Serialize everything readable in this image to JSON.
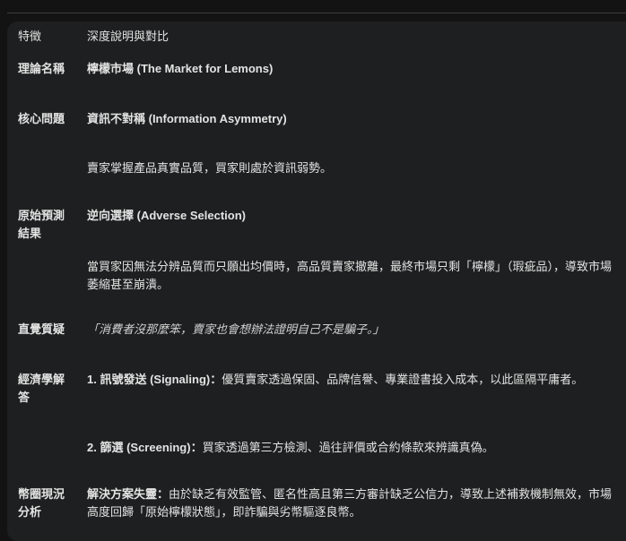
{
  "table": {
    "header": {
      "label": "特徵",
      "value": "深度說明與對比"
    },
    "rows": [
      {
        "label": "理論名稱",
        "value_bold": "檸檬市場 (The Market for Lemons)"
      },
      {
        "label": "核心問題",
        "value_bold": "資訊不對稱 (Information Asymmetry)",
        "detail": "賣家掌握產品真實品質，買家則處於資訊弱勢。"
      },
      {
        "label": "原始預測結果",
        "value_bold": "逆向選擇 (Adverse Selection)",
        "detail": "當買家因無法分辨品質而只願出均價時，高品質賣家撤離，最終市場只剩「檸檬」（瑕疵品），導致市場萎縮甚至崩潰。"
      },
      {
        "label": "直覺質疑",
        "value_italic": "「消費者沒那麼笨，賣家也會想辦法證明自己不是騙子。」"
      },
      {
        "label": "經濟學解答",
        "item1_bold": "1. 訊號發送 (Signaling)：",
        "item1_text": "優質賣家透過保固、品牌信譽、專業證書投入成本，以此區隔平庸者。",
        "item2_bold": "2. 篩選 (Screening)：",
        "item2_text": "買家透過第三方檢測、過往評價或合約條款來辨識真偽。"
      },
      {
        "label": "幣圈現況分析",
        "value_bold": "解決方案失靈：",
        "value_text": "由於缺乏有效監管、匿名性高且第三方審計缺乏公信力，導致上述補救機制無效，市場高度回歸「原始檸檬狀態」，即詐騙與劣幣驅逐良幣。"
      }
    ]
  }
}
